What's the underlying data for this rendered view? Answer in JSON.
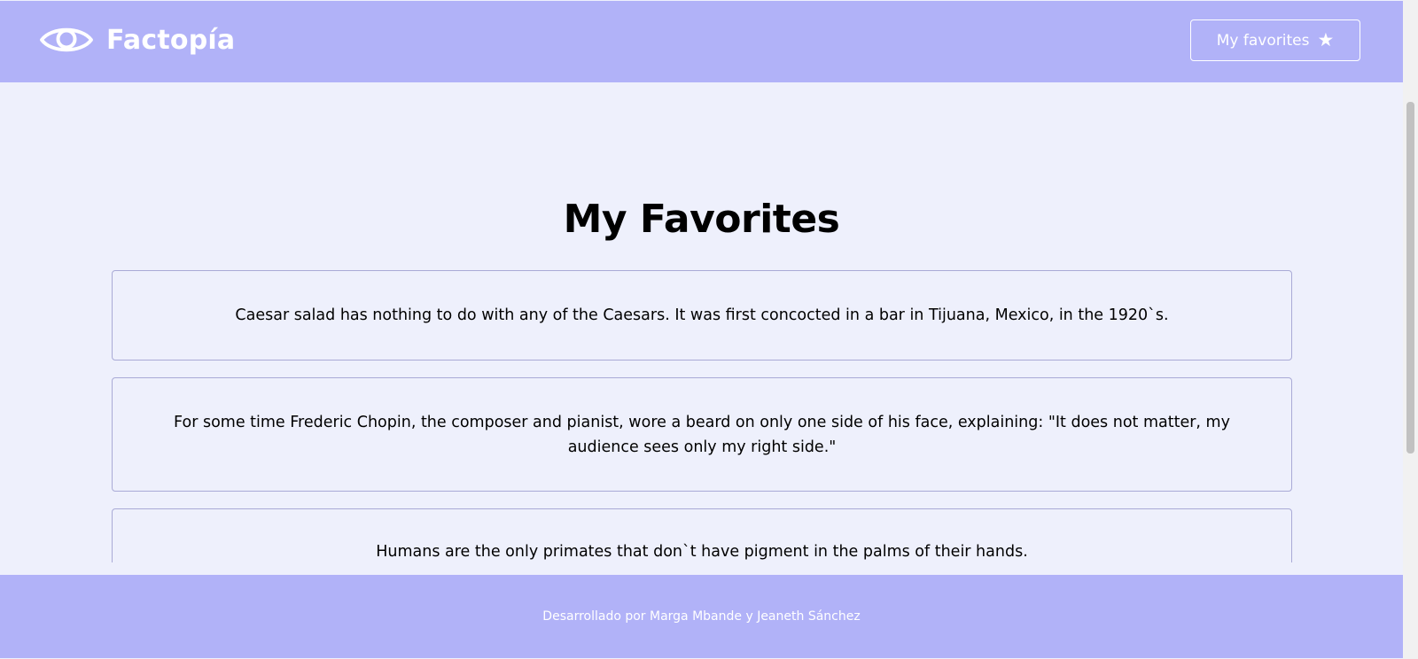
{
  "header": {
    "brand": "Factopía",
    "favorites_button": "My favorites",
    "favorites_icon": "★"
  },
  "main": {
    "title": "My Favorites",
    "facts": [
      {
        "text": "Caesar salad has nothing to do with any of the Caesars. It was first concocted in a bar in Tijuana, Mexico, in the 1920`s."
      },
      {
        "text": "For some time Frederic Chopin, the composer and pianist, wore a beard on only one side of his face, explaining: \"It does not matter, my audience sees only my right side.\""
      },
      {
        "text": "Humans are the only primates that don`t have pigment in the palms of their hands."
      }
    ]
  },
  "footer": {
    "credits": "Desarrollado por Marga Mbande y Jeaneth Sánchez"
  },
  "colors": {
    "brand_bar": "#b1b2f8",
    "page_background": "#eef0fc",
    "card_border": "#a9aad6",
    "text": "#000000"
  },
  "icons": {
    "logo": "eye-icon",
    "favorites": "star-icon"
  }
}
